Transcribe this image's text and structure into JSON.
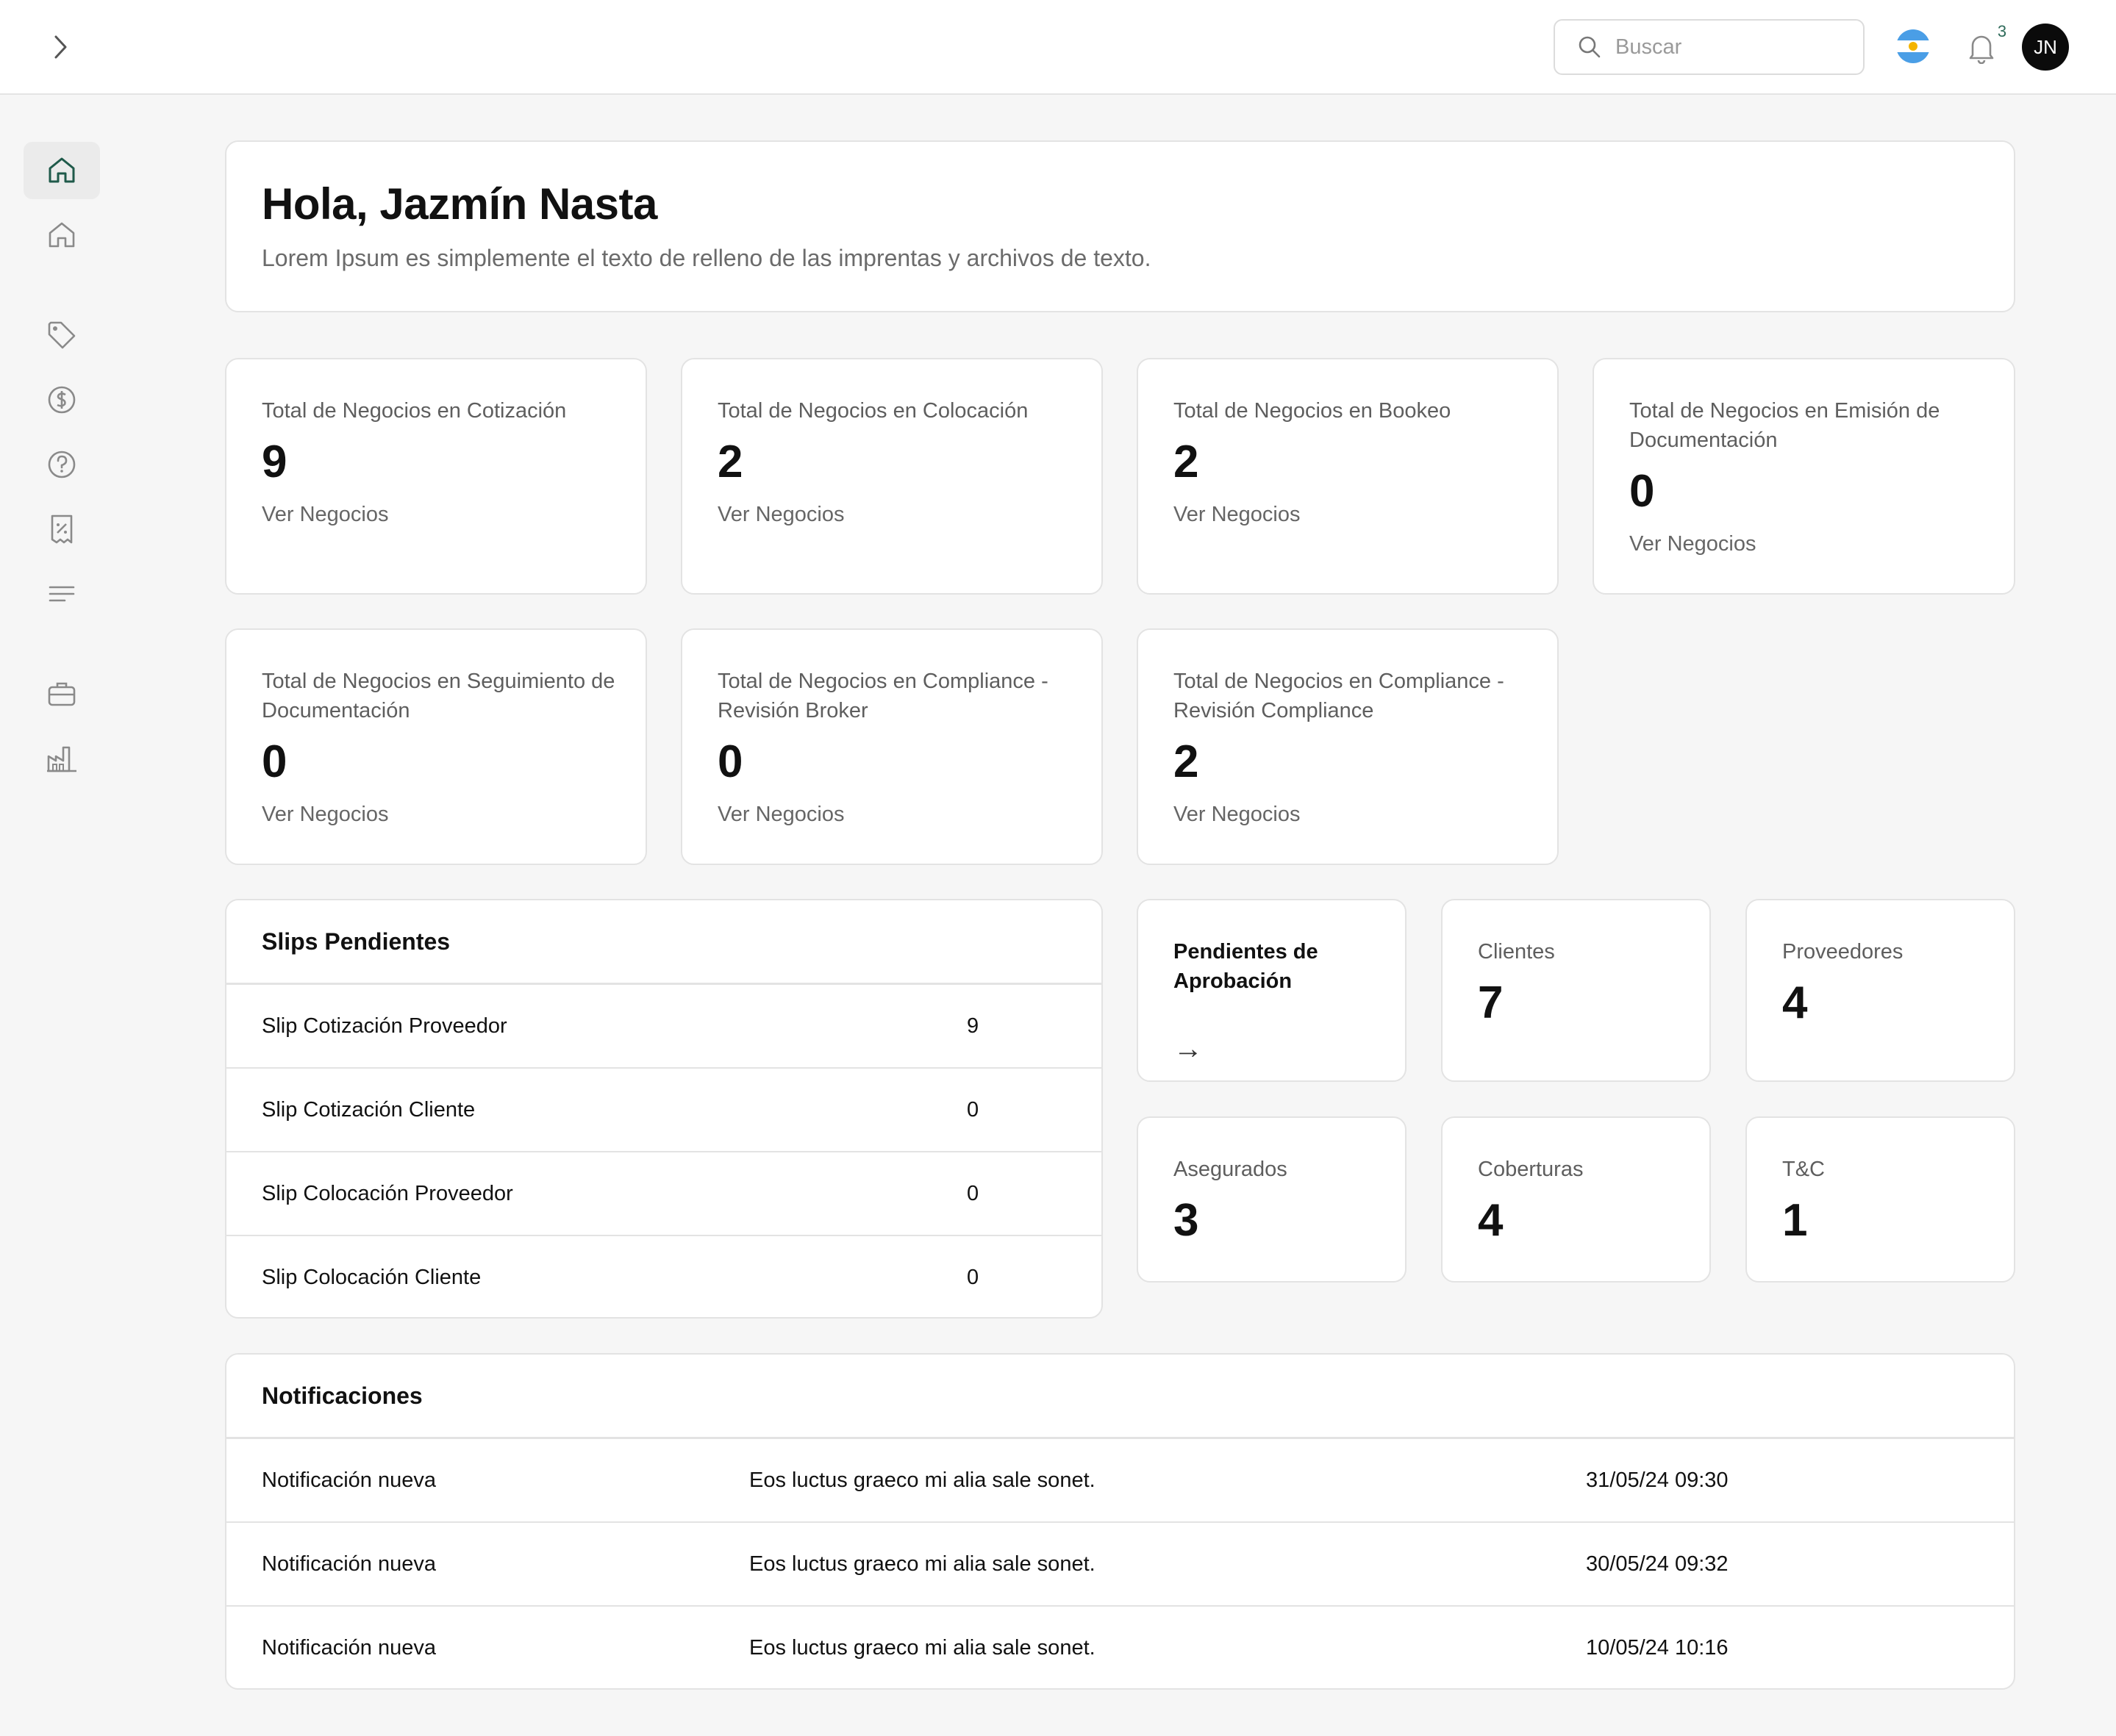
{
  "header": {
    "search_placeholder": "Buscar",
    "notification_count": "3",
    "avatar_initials": "JN",
    "flag_icon": "argentina-flag-icon"
  },
  "sidebar": {
    "items": [
      {
        "icon": "home-icon",
        "active": true
      },
      {
        "icon": "home-outline-icon"
      },
      {
        "icon": "tag-icon"
      },
      {
        "icon": "dollar-icon"
      },
      {
        "icon": "help-icon"
      },
      {
        "icon": "receipt-percent-icon"
      },
      {
        "icon": "list-icon"
      },
      {
        "icon": "briefcase-icon"
      },
      {
        "icon": "factory-icon"
      }
    ]
  },
  "greeting": {
    "title": "Hola, Jazmín Nasta",
    "subtitle": "Lorem Ipsum es simplemente el texto de relleno de las imprentas y archivos de texto."
  },
  "stats": [
    {
      "label": "Total de Negocios en Cotización",
      "value": "9",
      "link": "Ver Negocios"
    },
    {
      "label": "Total de Negocios en Colocación",
      "value": "2",
      "link": "Ver Negocios"
    },
    {
      "label": "Total de Negocios en Bookeo",
      "value": "2",
      "link": "Ver Negocios"
    },
    {
      "label": "Total de Negocios en Emisión de Documentación",
      "value": "0",
      "link": "Ver Negocios"
    },
    {
      "label": "Total de Negocios en Seguimiento de Documentación",
      "value": "0",
      "link": "Ver Negocios"
    },
    {
      "label": "Total de Negocios en Compliance - Revisión Broker",
      "value": "0",
      "link": "Ver Negocios"
    },
    {
      "label": "Total de Negocios en Compliance - Revisión Compliance",
      "value": "2",
      "link": "Ver Negocios"
    }
  ],
  "slips": {
    "title": "Slips Pendientes",
    "rows": [
      {
        "name": "Slip Cotización Proveedor",
        "count": "9"
      },
      {
        "name": "Slip Cotización Cliente",
        "count": "0"
      },
      {
        "name": "Slip Colocación Proveedor",
        "count": "0"
      },
      {
        "name": "Slip Colocación Cliente",
        "count": "0"
      }
    ]
  },
  "mini": {
    "pending": {
      "label": "Pendientes de Aprobación",
      "arrow": "→"
    },
    "clientes": {
      "label": "Clientes",
      "value": "7"
    },
    "proveedores": {
      "label": "Proveedores",
      "value": "4"
    },
    "asegurados": {
      "label": "Asegurados",
      "value": "3"
    },
    "coberturas": {
      "label": "Coberturas",
      "value": "4"
    },
    "tyc": {
      "label": "T&C",
      "value": "1"
    }
  },
  "notifications": {
    "title": "Notificaciones",
    "rows": [
      {
        "type": "Notificación nueva",
        "message": "Eos luctus graeco mi alia sale sonet.",
        "date": "31/05/24 09:30"
      },
      {
        "type": "Notificación nueva",
        "message": "Eos luctus graeco mi alia sale sonet.",
        "date": "30/05/24 09:32"
      },
      {
        "type": "Notificación nueva",
        "message": "Eos luctus graeco mi alia sale sonet.",
        "date": "10/05/24 10:16"
      }
    ]
  },
  "colors": {
    "accent": "#1f5a4a",
    "icon_gray": "#8a8a8a",
    "border": "#e3e3e3"
  }
}
